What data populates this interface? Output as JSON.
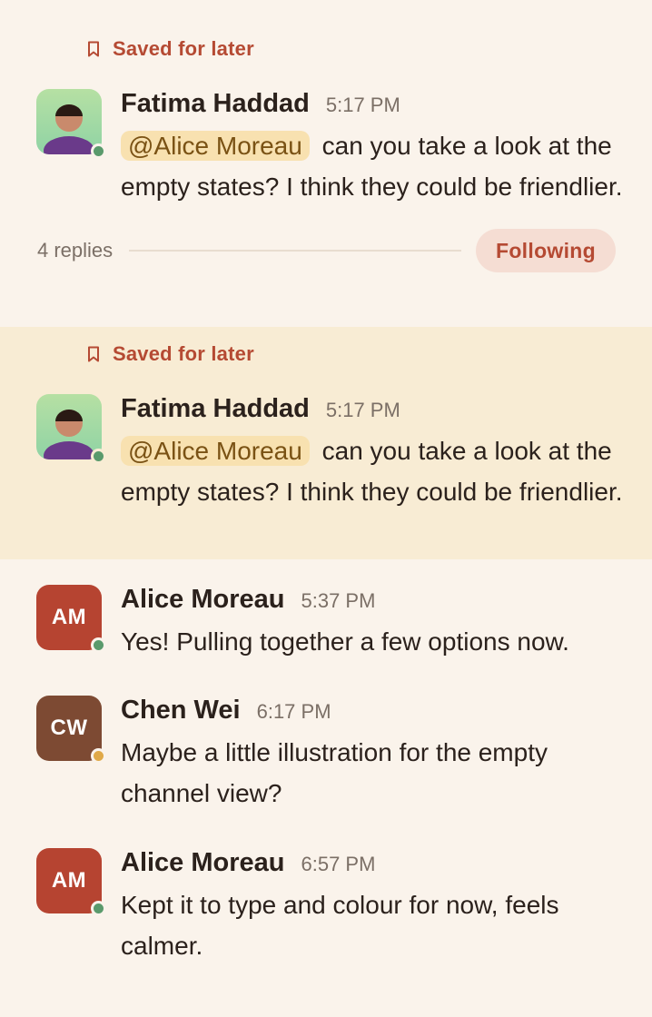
{
  "colors": {
    "background": "#faf3eb",
    "highlight": "#f8ecd4",
    "accent": "#b54a33",
    "mention_bg": "#f8e1b0",
    "online": "#5a9a6c",
    "away": "#e0a948"
  },
  "thread1": {
    "saved_label": "Saved for later",
    "message": {
      "author": "Fatima Haddad",
      "time": "5:17 PM",
      "mention": "@Alice Moreau",
      "text": "can you take a look at the empty states? I think they could be friendlier.",
      "presence": "online"
    },
    "replies_count": "4 replies",
    "following_label": "Following"
  },
  "thread2": {
    "saved_label": "Saved for later",
    "message": {
      "author": "Fatima Haddad",
      "time": "5:17 PM",
      "mention": "@Alice Moreau",
      "text": "can you take a look at the empty states? I think they could be friendlier.",
      "presence": "online"
    }
  },
  "replies": [
    {
      "initials": "AM",
      "author": "Alice Moreau",
      "time": "5:37 PM",
      "text": "Yes! Pulling together a few options now.",
      "presence": "online"
    },
    {
      "initials": "CW",
      "author": "Chen Wei",
      "time": "6:17 PM",
      "text": "Maybe a little illustration for the empty channel view?",
      "presence": "away"
    },
    {
      "initials": "AM",
      "author": "Alice Moreau",
      "time": "6:57 PM",
      "text": "Kept it to type and colour for now, feels calmer.",
      "presence": "online"
    }
  ]
}
